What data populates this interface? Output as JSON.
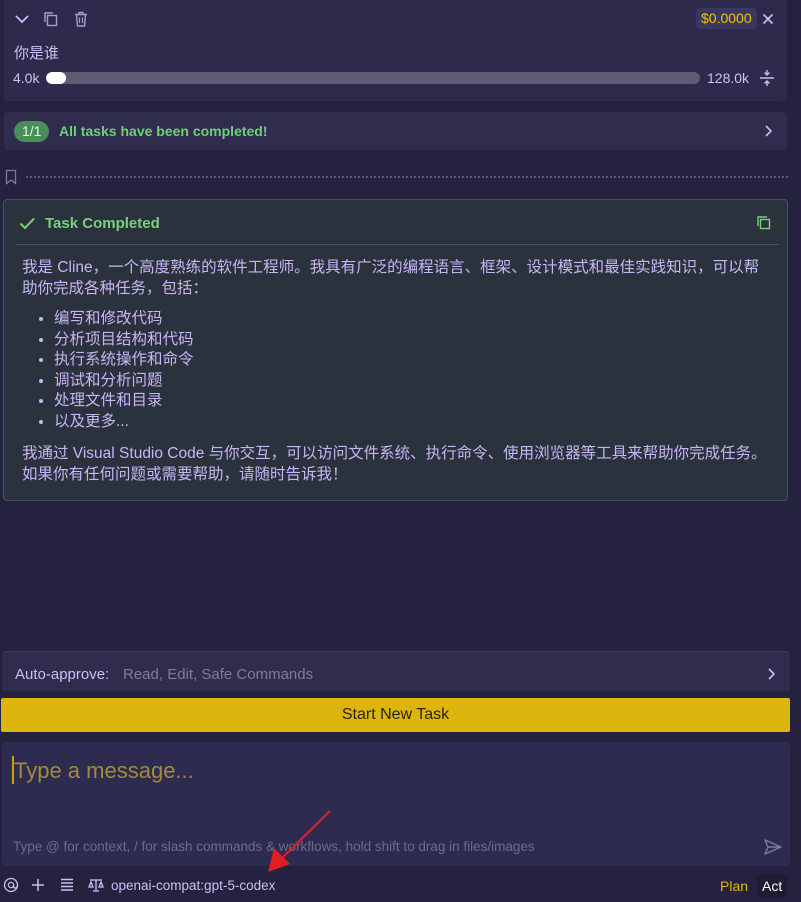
{
  "task_header": {
    "cost": "$0.0000",
    "task_text": "你是谁",
    "context_used": "4.0k",
    "context_total": "128.0k",
    "context_progress": 0.03
  },
  "tasks_row": {
    "badge": "1/1",
    "text": "All tasks have been completed!"
  },
  "completion": {
    "title": "Task Completed",
    "intro": "我是 Cline，一个高度熟练的软件工程师。我具有广泛的编程语言、框架、设计模式和最佳实践知识，可以帮助你完成各种任务，包括：",
    "items": [
      "编写和修改代码",
      "分析项目结构和代码",
      "执行系统操作和命令",
      "调试和分析问题",
      "处理文件和目录",
      "以及更多..."
    ],
    "outro": "我通过 Visual Studio Code 与你交互，可以访问文件系统、执行命令、使用浏览器等工具来帮助你完成任务。如果你有任何问题或需要帮助，请随时告诉我！"
  },
  "auto_approve": {
    "label": "Auto-approve:",
    "value": "Read, Edit, Safe Commands"
  },
  "start_new_task_label": "Start New Task",
  "message_input": {
    "placeholder": "Type a message...",
    "hint": "Type @ for context, / for slash commands & workflows, hold shift to drag in files/images"
  },
  "bottom_bar": {
    "model": "openai-compat:gpt-5-codex",
    "plan_label": "Plan",
    "act_label": "Act"
  },
  "colors": {
    "background": "#25223f",
    "accent_yellow": "#dcb60c",
    "success_green": "#78d07c",
    "arrow_red": "#e02020"
  },
  "icons": [
    "chevron-down-icon",
    "copy-icon",
    "trash-icon",
    "close-icon",
    "compress-icon",
    "chevron-right-icon",
    "bookmark-icon",
    "check-icon",
    "at-icon",
    "plus-icon",
    "rules-icon",
    "model-icon",
    "send-icon",
    "arrow-annotation-icon"
  ]
}
